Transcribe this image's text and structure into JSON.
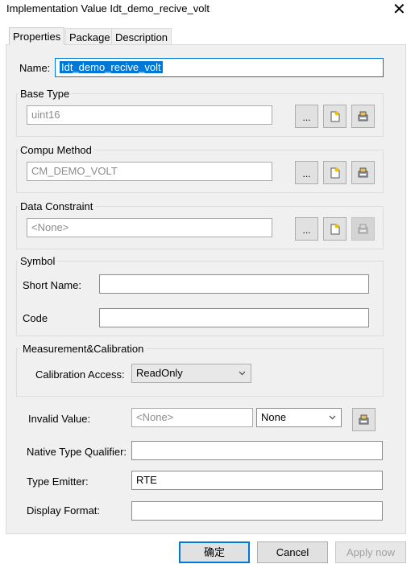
{
  "window": {
    "title": "Implementation Value Idt_demo_recive_volt"
  },
  "tabs": [
    "Properties",
    "Package",
    "Description"
  ],
  "name_field": {
    "label": "Name:",
    "value": "Idt_demo_recive_volt"
  },
  "base_type": {
    "title": "Base Type",
    "value": "uint16"
  },
  "compu_method": {
    "title": "Compu Method",
    "value": "CM_DEMO_VOLT"
  },
  "data_constraint": {
    "title": "Data Constraint",
    "value": "<None>"
  },
  "browse_label": "...",
  "symbol": {
    "title": "Symbol",
    "short_name_label": "Short Name:",
    "short_name_value": "",
    "code_label": "Code",
    "code_value": ""
  },
  "measurement": {
    "title": "Measurement&Calibration",
    "calibration_label": "Calibration Access:",
    "calibration_value": "ReadOnly"
  },
  "invalid_value": {
    "label": "Invalid Value:",
    "value": "<None>",
    "select_value": "None"
  },
  "native_type_qualifier": {
    "label": "Native Type Qualifier:",
    "value": ""
  },
  "type_emitter": {
    "label": "Type Emitter:",
    "value": "RTE"
  },
  "display_format": {
    "label": "Display Format:",
    "value": ""
  },
  "buttons": {
    "ok": "确定",
    "cancel": "Cancel",
    "apply": "Apply now"
  }
}
